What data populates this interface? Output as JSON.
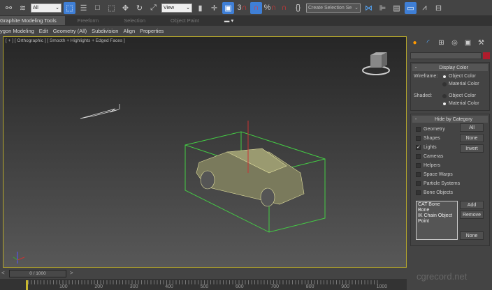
{
  "toolbar": {
    "filter": "All",
    "coord_system": "View",
    "selection_set": "Create Selection Se",
    "snap_3d": "3",
    "snap_pct": "%"
  },
  "ribbon": {
    "tabs": [
      "Graphite Modeling Tools",
      "Freeform",
      "Selection",
      "Object Paint"
    ]
  },
  "subribbon": [
    "ygon Modeling",
    "Edit",
    "Geometry (All)",
    "Subdivision",
    "Align",
    "Properties"
  ],
  "viewport": {
    "label": "[ + ] [ Orthographic ] [ Smooth + Highlights + Edged Faces ]"
  },
  "panel": {
    "display_color": {
      "title": "Display Color",
      "wireframe_label": "Wireframe:",
      "shaded_label": "Shaded:",
      "object_color": "Object Color",
      "material_color": "Material Color",
      "wireframe_selected": "Object Color",
      "shaded_selected": "Material Color"
    },
    "hide_by_category": {
      "title": "Hide by Category",
      "items": [
        {
          "label": "Geometry",
          "checked": false
        },
        {
          "label": "Shapes",
          "checked": false
        },
        {
          "label": "Lights",
          "checked": true
        },
        {
          "label": "Cameras",
          "checked": false
        },
        {
          "label": "Helpers",
          "checked": false
        },
        {
          "label": "Space Warps",
          "checked": false
        },
        {
          "label": "Particle Systems",
          "checked": false
        },
        {
          "label": "Bone Objects",
          "checked": false
        }
      ],
      "buttons": {
        "all": "All",
        "none": "None",
        "invert": "Invert",
        "add": "Add",
        "remove": "Remove",
        "none2": "None"
      },
      "list": [
        "CAT Bone",
        "Bone",
        "IK Chain Object",
        "Point"
      ]
    },
    "swatch_color": "#b01c2c"
  },
  "timeline": {
    "frame": "0 / 1000",
    "ticks": [
      "100",
      "200",
      "300",
      "400",
      "500",
      "600",
      "700",
      "800",
      "900",
      "1000"
    ]
  },
  "watermark": "cgrecord.net"
}
